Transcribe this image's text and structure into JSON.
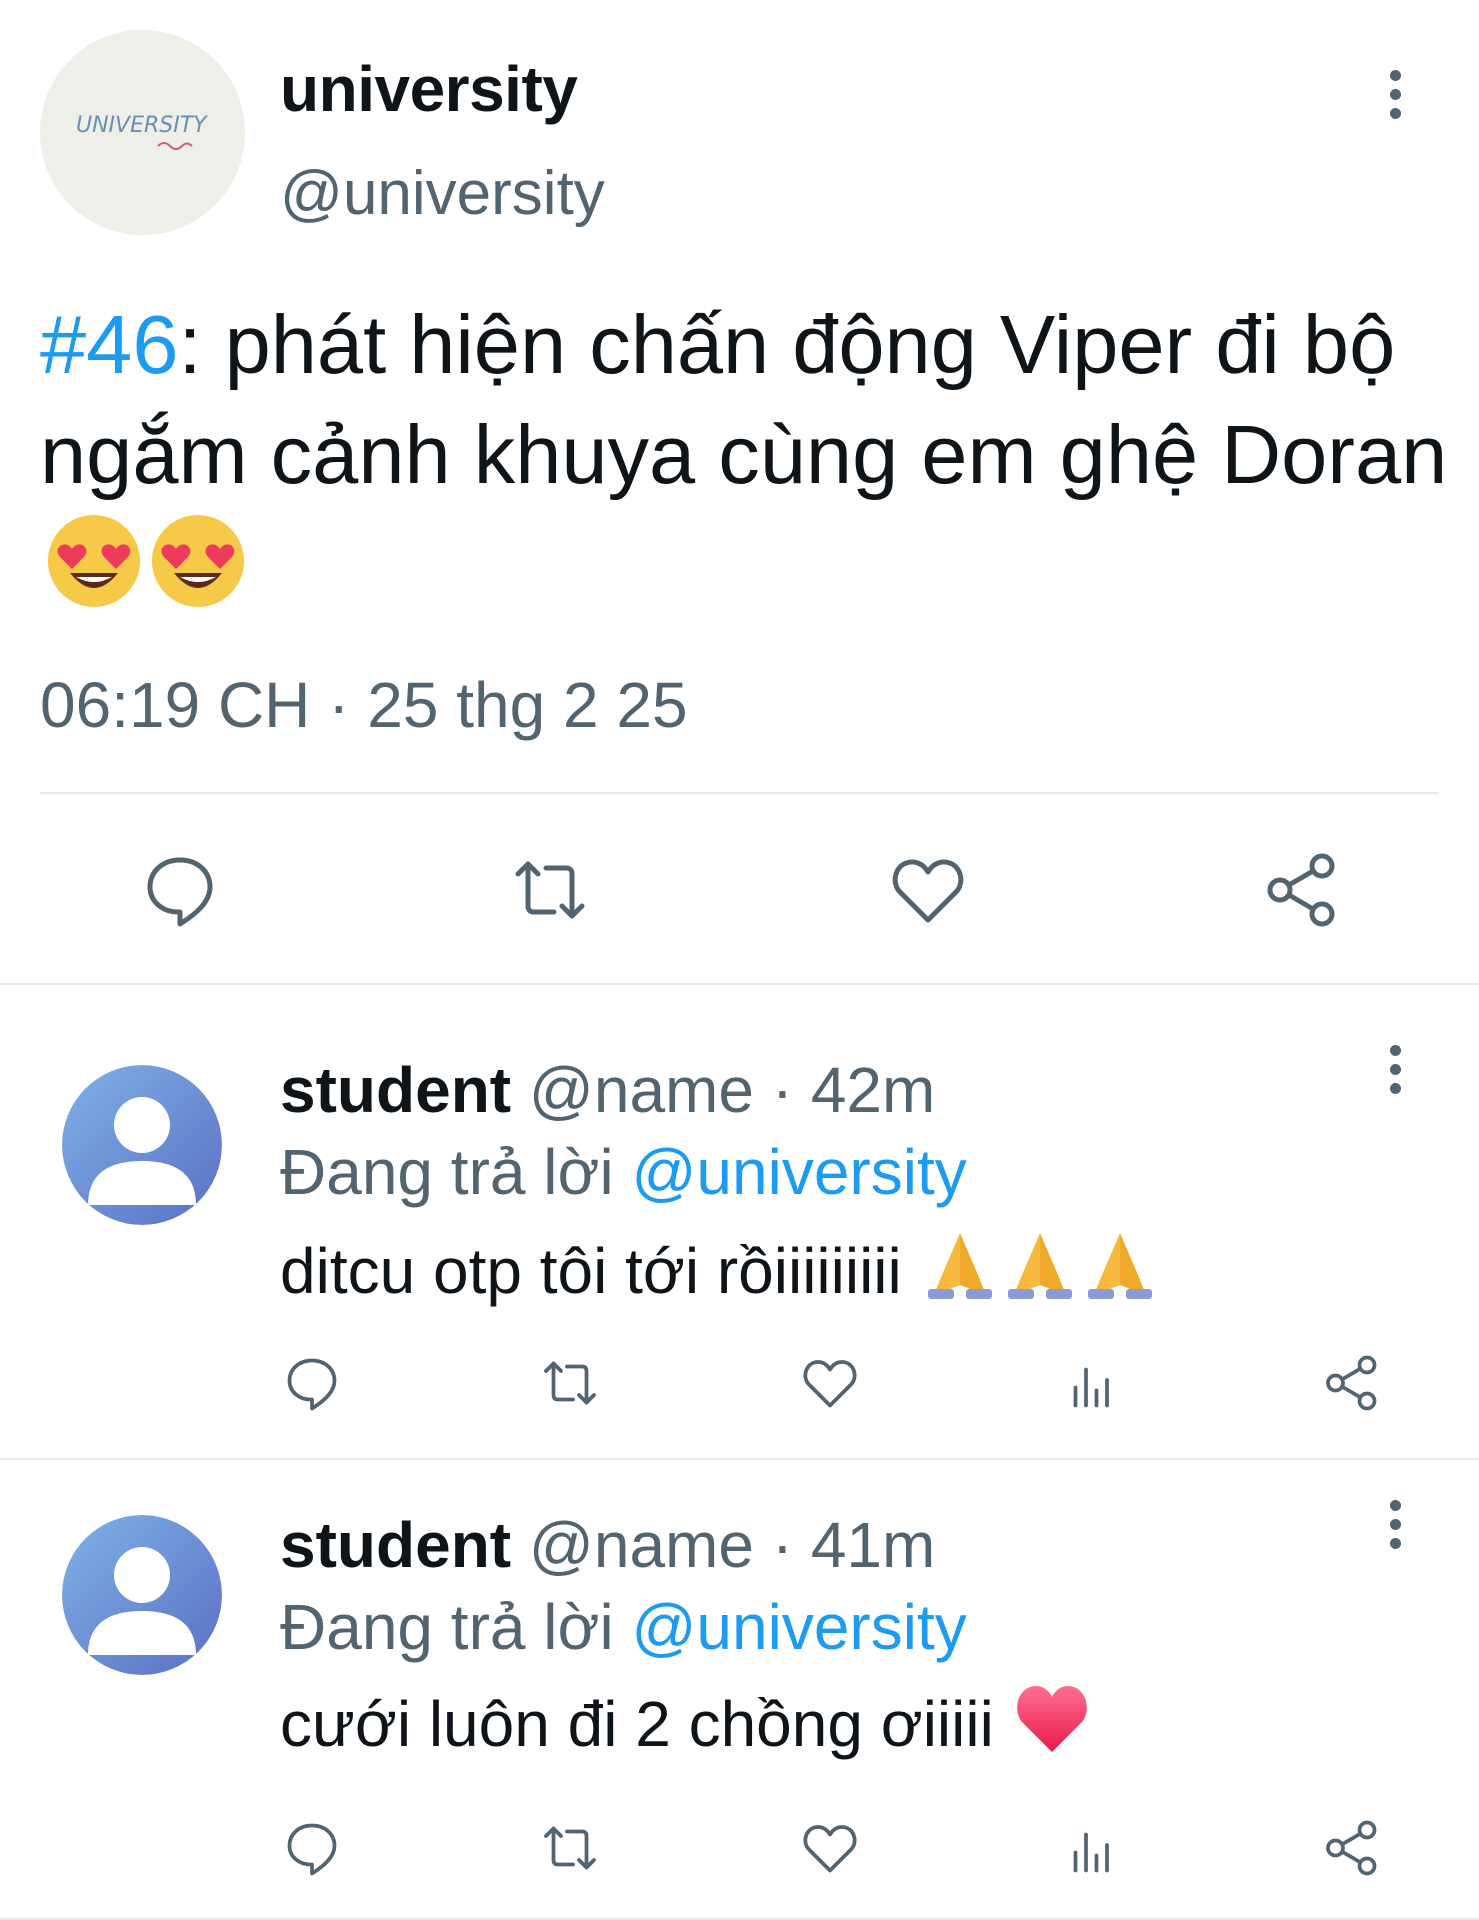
{
  "main_tweet": {
    "avatar_text": "UNIVERSITY",
    "name": "university",
    "handle": "@university",
    "hashtag": "#46",
    "text": ": phát hiện chấn động Viper đi bộ ngắm cảnh khuya cùng em ghệ Doran ",
    "emoji": "smiling-face-with-heart-eyes",
    "timestamp": "06:19 CH · 25 thg 2 25",
    "actions": [
      "reply-icon",
      "retweet-icon",
      "like-icon",
      "share-icon"
    ]
  },
  "replies": [
    {
      "name": "student",
      "meta": " @name · 42m",
      "replying_prefix": "Đang trả lời ",
      "replying_to": "@university",
      "text": "ditcu otp tôi tới rồiiiiiiiii ",
      "emoji": "folded-hands"
    },
    {
      "name": "student",
      "meta": " @name · 41m",
      "replying_prefix": "Đang trả lời ",
      "replying_to": "@university",
      "text": "cưới luôn đi 2 chồng ơiiiii ",
      "emoji": "red-heart"
    }
  ],
  "colors": {
    "link": "#1d9bf0",
    "secondary_text": "#536471",
    "divider": "#e6e9ec"
  }
}
